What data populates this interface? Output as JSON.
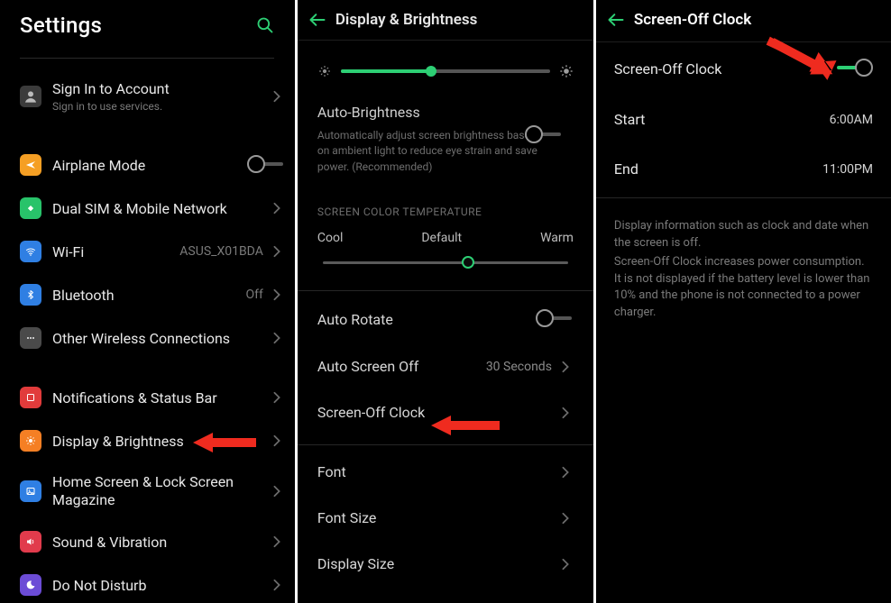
{
  "panel1": {
    "title": "Settings",
    "signin": {
      "title": "Sign In to Account",
      "sub": "Sign in to use services."
    },
    "airplane": {
      "label": "Airplane Mode"
    },
    "dualsim": {
      "label": "Dual SIM & Mobile Network"
    },
    "wifi": {
      "label": "Wi-Fi",
      "value": "ASUS_X01BDA"
    },
    "bluetooth": {
      "label": "Bluetooth",
      "value": "Off"
    },
    "otherconn": {
      "label": "Other Wireless Connections"
    },
    "notif": {
      "label": "Notifications & Status Bar"
    },
    "display": {
      "label": "Display & Brightness"
    },
    "home": {
      "label": "Home Screen & Lock Screen Magazine"
    },
    "sound": {
      "label": "Sound & Vibration"
    },
    "dnd": {
      "label": "Do Not Disturb"
    }
  },
  "panel2": {
    "title": "Display & Brightness",
    "brightness_pct": 43,
    "autobright": {
      "label": "Auto-Brightness",
      "desc": "Automatically adjust screen brightness based on ambient light to reduce eye strain and save power. (Recommended)"
    },
    "temp_caption": "SCREEN COLOR TEMPERATURE",
    "temp_labels": {
      "cool": "Cool",
      "default": "Default",
      "warm": "Warm"
    },
    "temp_pct": 60,
    "autorotate": {
      "label": "Auto Rotate"
    },
    "autoscreenoff": {
      "label": "Auto Screen Off",
      "value": "30 Seconds"
    },
    "screenoffclk": {
      "label": "Screen-Off Clock"
    },
    "font": {
      "label": "Font"
    },
    "fontsize": {
      "label": "Font Size"
    },
    "displaysize": {
      "label": "Display Size"
    }
  },
  "panel3": {
    "title": "Screen-Off Clock",
    "toggle": {
      "label": "Screen-Off Clock"
    },
    "start": {
      "label": "Start",
      "value": "6:00AM"
    },
    "end": {
      "label": "End",
      "value": "11:00PM"
    },
    "note1": "Display information such as clock and date when the screen is off.",
    "note2": "Screen-Off Clock increases power consumption. It is not displayed if the battery level is lower than 10% and the phone is not connected to a power charger."
  }
}
